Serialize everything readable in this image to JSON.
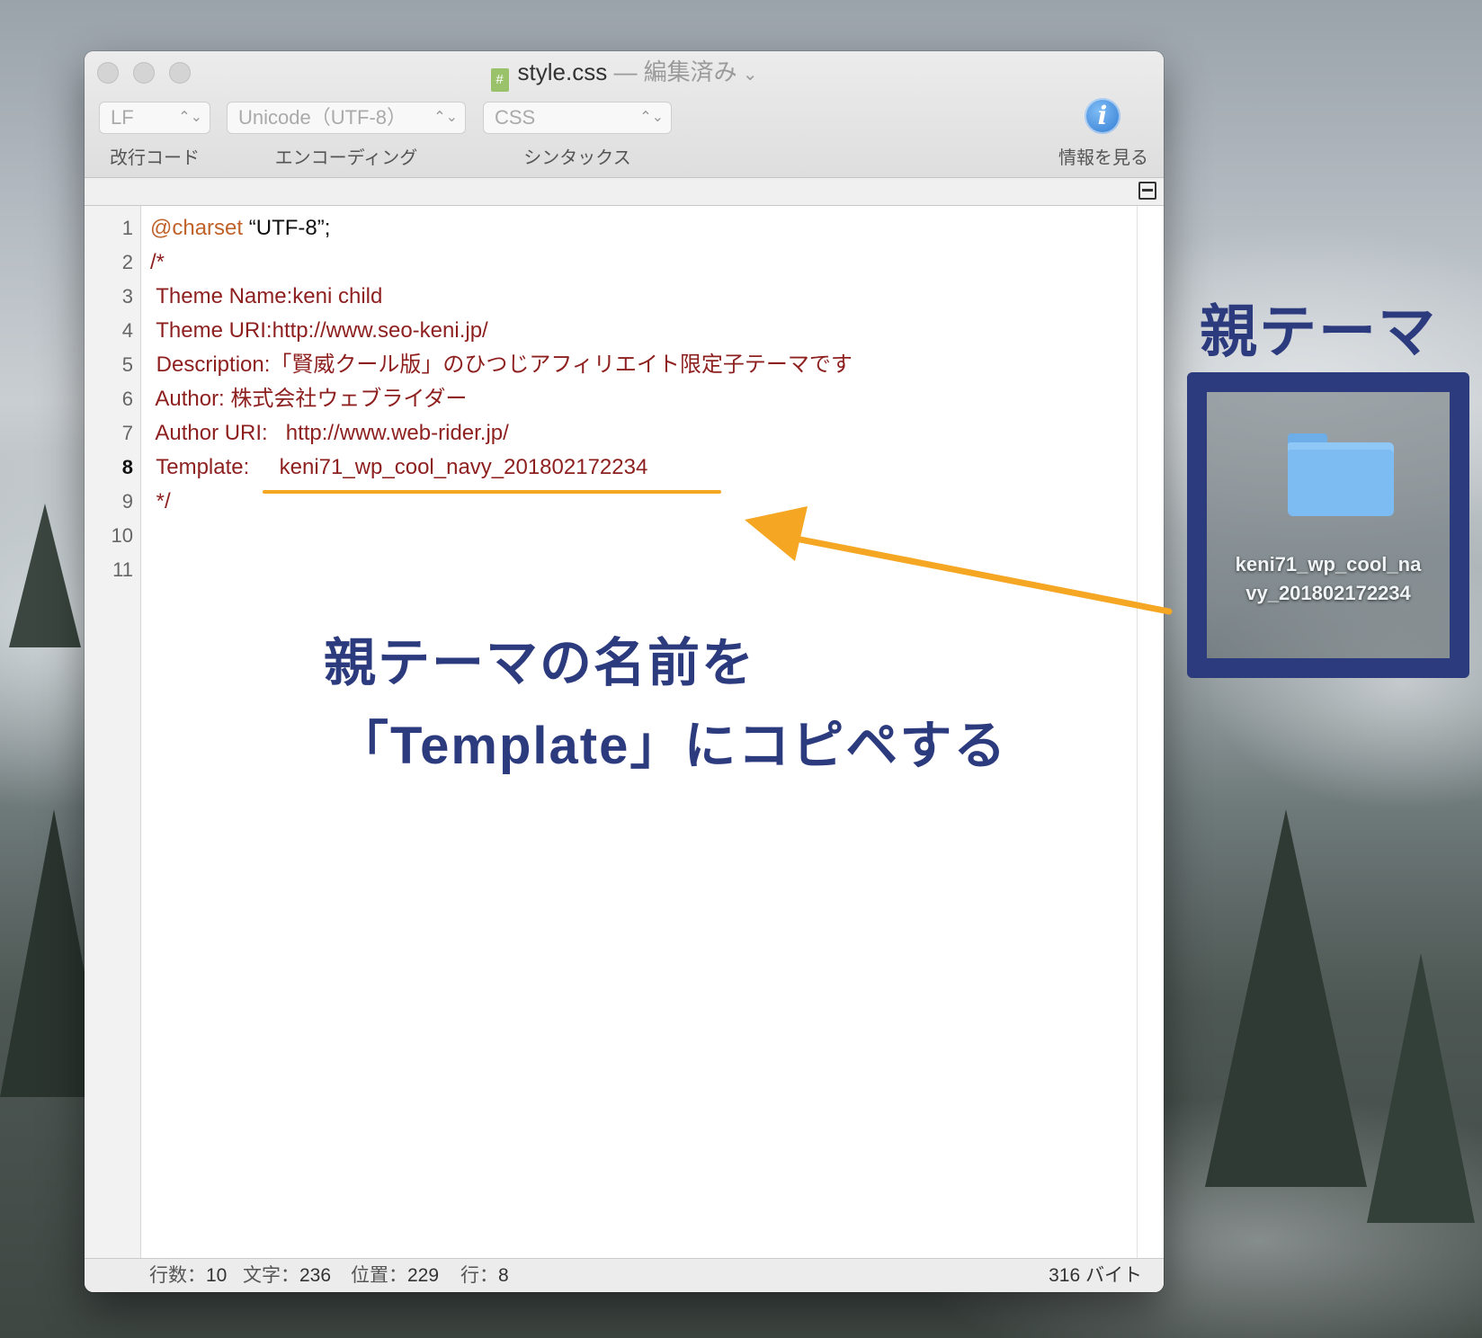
{
  "window": {
    "title": "style.css",
    "title_sep": " — ",
    "title_status": "編集済み",
    "title_chevron": "⌄",
    "doc_icon": "#"
  },
  "toolbar": {
    "line_ending": {
      "value": "LF",
      "label": "改行コード"
    },
    "encoding": {
      "value": "Unicode（UTF-8）",
      "label": "エンコーディング"
    },
    "syntax": {
      "value": "CSS",
      "label": "シンタックス"
    },
    "info": {
      "glyph": "i",
      "label": "情報を見る"
    },
    "popup_arrows": "⌃⌄"
  },
  "editor": {
    "current_line": 8,
    "line_numbers": [
      "1",
      "2",
      "3",
      "4",
      "5",
      "6",
      "7",
      "8",
      "9",
      "10",
      "11"
    ],
    "lines": [
      {
        "at": "@charset",
        "str": " “UTF-8”;",
        "text": ""
      },
      {
        "at": "",
        "str": "",
        "text": "/*"
      },
      {
        "at": "",
        "str": "",
        "text": " Theme Name:keni child"
      },
      {
        "at": "",
        "str": "",
        "text": " Theme URI:http://www.seo-keni.jp/"
      },
      {
        "at": "",
        "str": "",
        "text": " Description:「賢威クール版」のひつじアフィリエイト限定子テーマです"
      },
      {
        "at": "",
        "str": "",
        "text": " Author: 株式会社ウェブライダー"
      },
      {
        "at": "",
        "str": "",
        "text": " Author URI:   http://www.web-rider.jp/"
      },
      {
        "at": "",
        "str": "",
        "text": " Template:     keni71_wp_cool_navy_201802172234"
      },
      {
        "at": "",
        "str": "",
        "text": " */"
      },
      {
        "at": "",
        "str": "",
        "text": ""
      },
      {
        "at": "",
        "str": "",
        "text": ""
      }
    ]
  },
  "statusbar": {
    "lines_label": "行数：",
    "lines_value": "10",
    "chars_label": "文字：",
    "chars_value": "236",
    "position_label": "位置：",
    "position_value": "229",
    "row_label": "行：",
    "row_value": "8",
    "bytes": "316 バイト"
  },
  "annotation": {
    "line1": "親テーマの名前を",
    "line2": "「Template」にコピペする",
    "right_label": "親テーマ",
    "folder_name_line1": "keni71_wp_cool_na",
    "folder_name_line2": "vy_201802172234",
    "accent_color": "#f5a623",
    "text_color": "#2c3a7e"
  }
}
